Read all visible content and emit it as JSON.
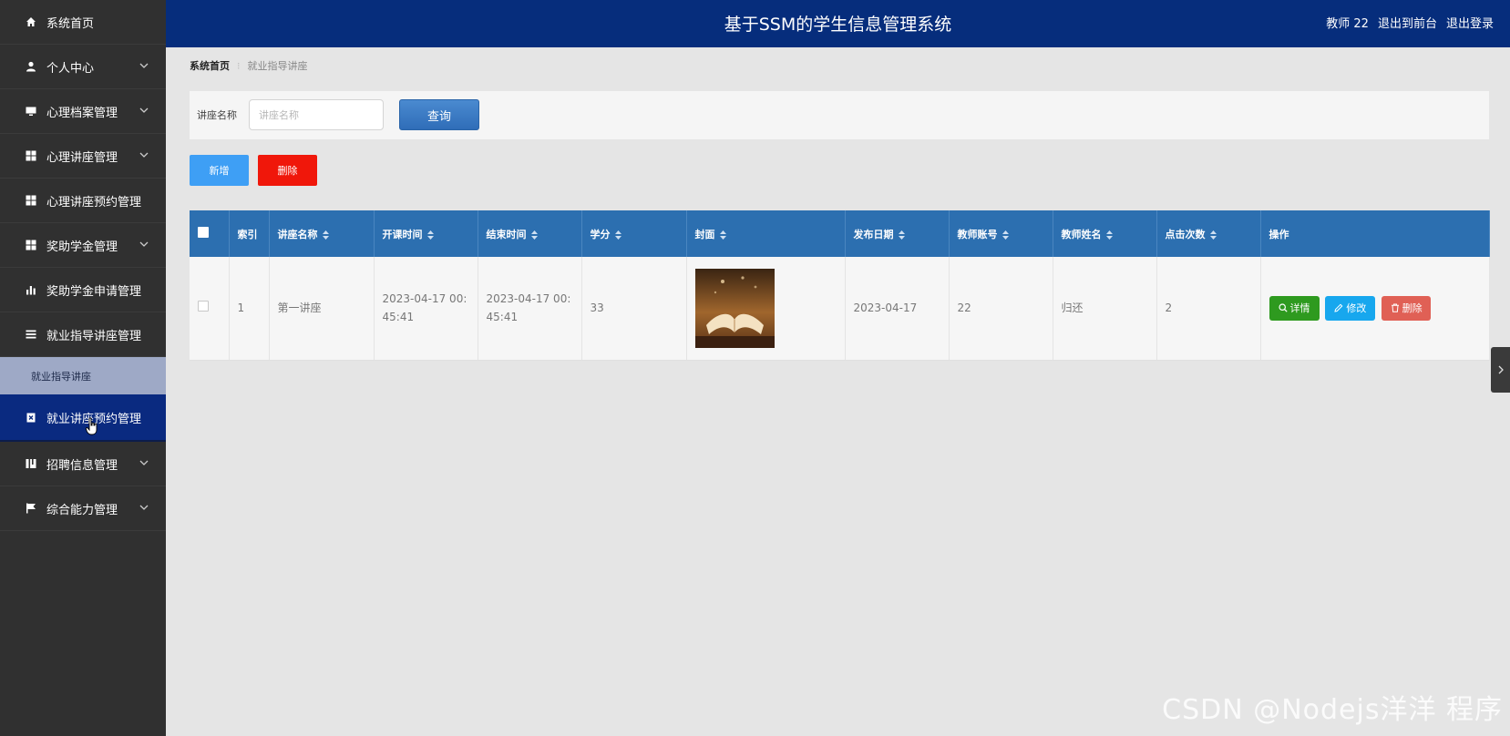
{
  "header": {
    "title": "基于SSM的学生信息管理系统",
    "user": "教师 22",
    "to_front": "退出到前台",
    "logout": "退出登录"
  },
  "sidebar": {
    "items": [
      {
        "label": "系统首页",
        "icon": "home-icon",
        "expandable": false
      },
      {
        "label": "个人中心",
        "icon": "user-icon",
        "expandable": true
      },
      {
        "label": "心理档案管理",
        "icon": "monitor-icon",
        "expandable": true
      },
      {
        "label": "心理讲座管理",
        "icon": "grid-icon",
        "expandable": true
      },
      {
        "label": "心理讲座预约管理",
        "icon": "grid-icon",
        "expandable": false
      },
      {
        "label": "奖助学金管理",
        "icon": "grid-icon",
        "expandable": true
      },
      {
        "label": "奖助学金申请管理",
        "icon": "bar-chart-icon",
        "expandable": false
      },
      {
        "label": "就业指导讲座管理",
        "icon": "list-icon",
        "expandable": false
      },
      {
        "label": "就业指导讲座",
        "sub": true
      },
      {
        "label": "就业讲座预约管理",
        "icon": "clipboard-icon",
        "expandable": false,
        "active": true
      },
      {
        "label": "招聘信息管理",
        "icon": "book-icon",
        "expandable": true
      },
      {
        "label": "综合能力管理",
        "icon": "flag-icon",
        "expandable": true
      }
    ]
  },
  "breadcrumb": {
    "home": "系统首页",
    "current": "就业指导讲座"
  },
  "search": {
    "label": "讲座名称",
    "placeholder": "讲座名称",
    "value": "",
    "button": "查询"
  },
  "actions": {
    "add": "新增",
    "delete": "删除"
  },
  "table": {
    "columns": [
      "索引",
      "讲座名称",
      "开课时间",
      "结束时间",
      "学分",
      "封面",
      "发布日期",
      "教师账号",
      "教师姓名",
      "点击次数",
      "操作"
    ],
    "rows": [
      {
        "index": "1",
        "name": "第一讲座",
        "start": "2023-04-17 00:45:41",
        "end": "2023-04-17 00:45:41",
        "credit": "33",
        "date": "2023-04-17",
        "teacher_account": "22",
        "teacher_name": "归还",
        "clicks": "2"
      }
    ],
    "ops": {
      "detail": "详情",
      "edit": "修改",
      "delete": "删除"
    }
  },
  "watermark": "CSDN @Nodejs洋洋  程序",
  "colors": {
    "sidebar_bg": "#303030",
    "header_bg": "#062d7c",
    "active_item": "#0a2a80",
    "table_header": "#2c6fb0",
    "detail_btn": "#2e9a1f",
    "edit_btn": "#17a7ee",
    "delete_btn": "#e06055"
  }
}
